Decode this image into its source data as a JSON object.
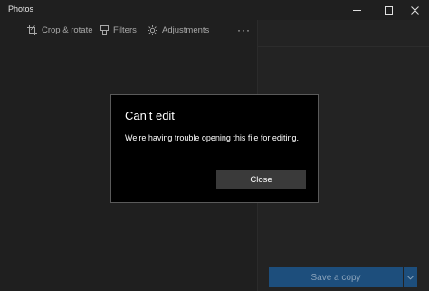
{
  "window": {
    "title": "Photos"
  },
  "toolbar": {
    "items": [
      {
        "label": "Crop & rotate",
        "icon": "crop-icon"
      },
      {
        "label": "Filters",
        "icon": "filters-icon"
      },
      {
        "label": "Adjustments",
        "icon": "adjustments-icon"
      }
    ],
    "more_label": "···"
  },
  "actions": {
    "save_label": "Save a copy"
  },
  "dialog": {
    "title": "Can’t edit",
    "message": "We’re having trouble opening this file for editing.",
    "close_label": "Close"
  },
  "colors": {
    "background": "#1f1f1f",
    "dialog_background": "#000000",
    "dialog_border": "#5a5a5a",
    "accent_disabled": "#1d4e7c",
    "button_gray": "#3a3a3a"
  }
}
